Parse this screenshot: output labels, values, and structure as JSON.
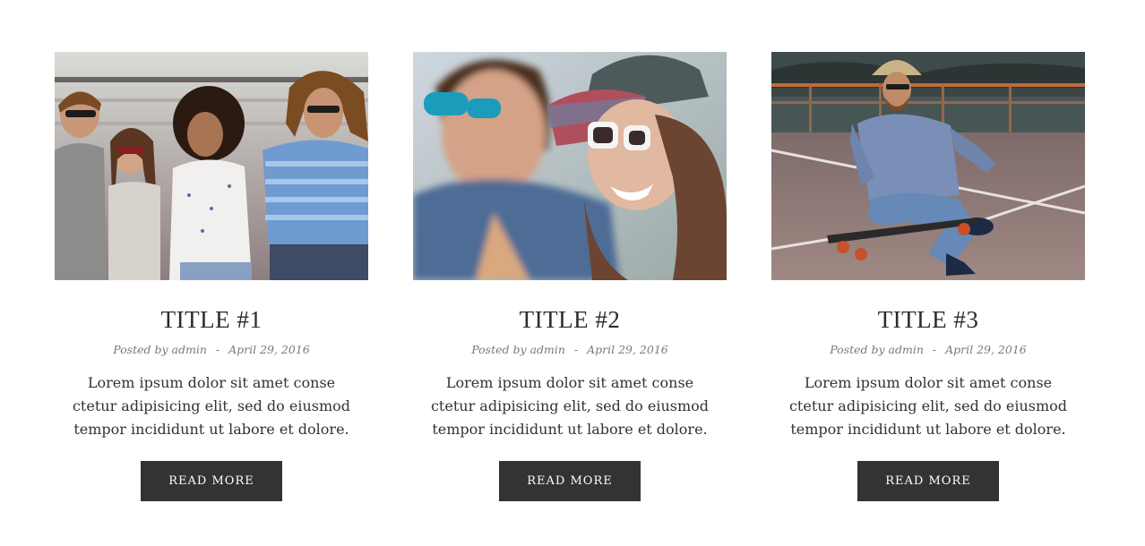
{
  "posts": [
    {
      "title": "TITLE #1",
      "posted_by": "Posted by",
      "author": "admin",
      "separator": "-",
      "date": "April 29, 2016",
      "excerpt": "Lorem ipsum dolor sit amet conse ctetur adipisicing elit, sed do eiusmod tempor incididunt ut labore et dolore.",
      "button": "READ MORE"
    },
    {
      "title": "TITLE #2",
      "posted_by": "Posted by",
      "author": "admin",
      "separator": "-",
      "date": "April 29, 2016",
      "excerpt": "Lorem ipsum dolor sit amet conse ctetur adipisicing elit, sed do eiusmod tempor incididunt ut labore et dolore.",
      "button": "READ MORE"
    },
    {
      "title": "TITLE #3",
      "posted_by": "Posted by",
      "author": "admin",
      "separator": "-",
      "date": "April 29, 2016",
      "excerpt": "Lorem ipsum dolor sit amet conse ctetur adipisicing elit, sed do eiusmod tempor incididunt ut labore et dolore.",
      "button": "READ MORE"
    }
  ],
  "colors": {
    "button_bg": "#333333",
    "button_text": "#ffffff",
    "title": "#2b2b2b",
    "meta": "#7a7a7a",
    "text": "#333333"
  }
}
